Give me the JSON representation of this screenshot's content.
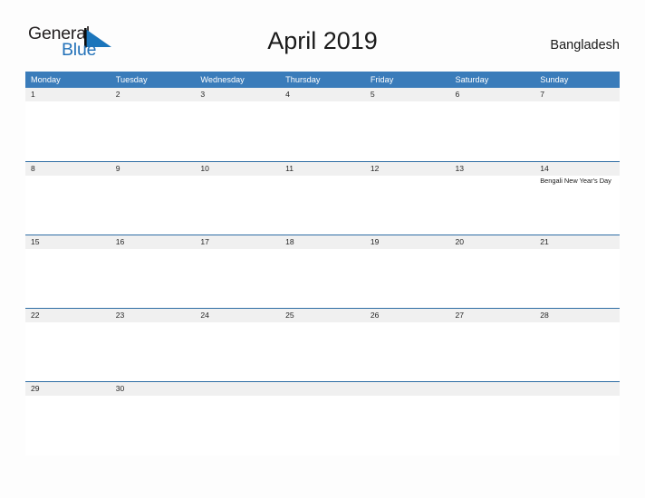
{
  "branding": {
    "logo_text_primary": "General",
    "logo_text_secondary": "Blue",
    "logo_flag_icon": "blue-flag-triangle-icon",
    "logo_primary_color": "#231f20",
    "logo_secondary_color": "#2372b9"
  },
  "header": {
    "title": "April 2019",
    "country": "Bangladesh"
  },
  "theme": {
    "header_blue": "#3a7cba",
    "row_divider_blue": "#2e6da4",
    "date_band_gray": "#f0f0f0",
    "page_background": "#fdfdfd",
    "text_dark": "#1a1a1a"
  },
  "calendar": {
    "month": "April",
    "year": "2019",
    "weekday_headers": [
      "Monday",
      "Tuesday",
      "Wednesday",
      "Thursday",
      "Friday",
      "Saturday",
      "Sunday"
    ],
    "weeks": [
      {
        "days": [
          {
            "date": "1",
            "event": ""
          },
          {
            "date": "2",
            "event": ""
          },
          {
            "date": "3",
            "event": ""
          },
          {
            "date": "4",
            "event": ""
          },
          {
            "date": "5",
            "event": ""
          },
          {
            "date": "6",
            "event": ""
          },
          {
            "date": "7",
            "event": ""
          }
        ]
      },
      {
        "days": [
          {
            "date": "8",
            "event": ""
          },
          {
            "date": "9",
            "event": ""
          },
          {
            "date": "10",
            "event": ""
          },
          {
            "date": "11",
            "event": ""
          },
          {
            "date": "12",
            "event": ""
          },
          {
            "date": "13",
            "event": ""
          },
          {
            "date": "14",
            "event": "Bengali New Year's Day"
          }
        ]
      },
      {
        "days": [
          {
            "date": "15",
            "event": ""
          },
          {
            "date": "16",
            "event": ""
          },
          {
            "date": "17",
            "event": ""
          },
          {
            "date": "18",
            "event": ""
          },
          {
            "date": "19",
            "event": ""
          },
          {
            "date": "20",
            "event": ""
          },
          {
            "date": "21",
            "event": ""
          }
        ]
      },
      {
        "days": [
          {
            "date": "22",
            "event": ""
          },
          {
            "date": "23",
            "event": ""
          },
          {
            "date": "24",
            "event": ""
          },
          {
            "date": "25",
            "event": ""
          },
          {
            "date": "26",
            "event": ""
          },
          {
            "date": "27",
            "event": ""
          },
          {
            "date": "28",
            "event": ""
          }
        ]
      },
      {
        "days": [
          {
            "date": "29",
            "event": ""
          },
          {
            "date": "30",
            "event": ""
          },
          {
            "date": "",
            "event": ""
          },
          {
            "date": "",
            "event": ""
          },
          {
            "date": "",
            "event": ""
          },
          {
            "date": "",
            "event": ""
          },
          {
            "date": "",
            "event": ""
          }
        ]
      }
    ]
  }
}
